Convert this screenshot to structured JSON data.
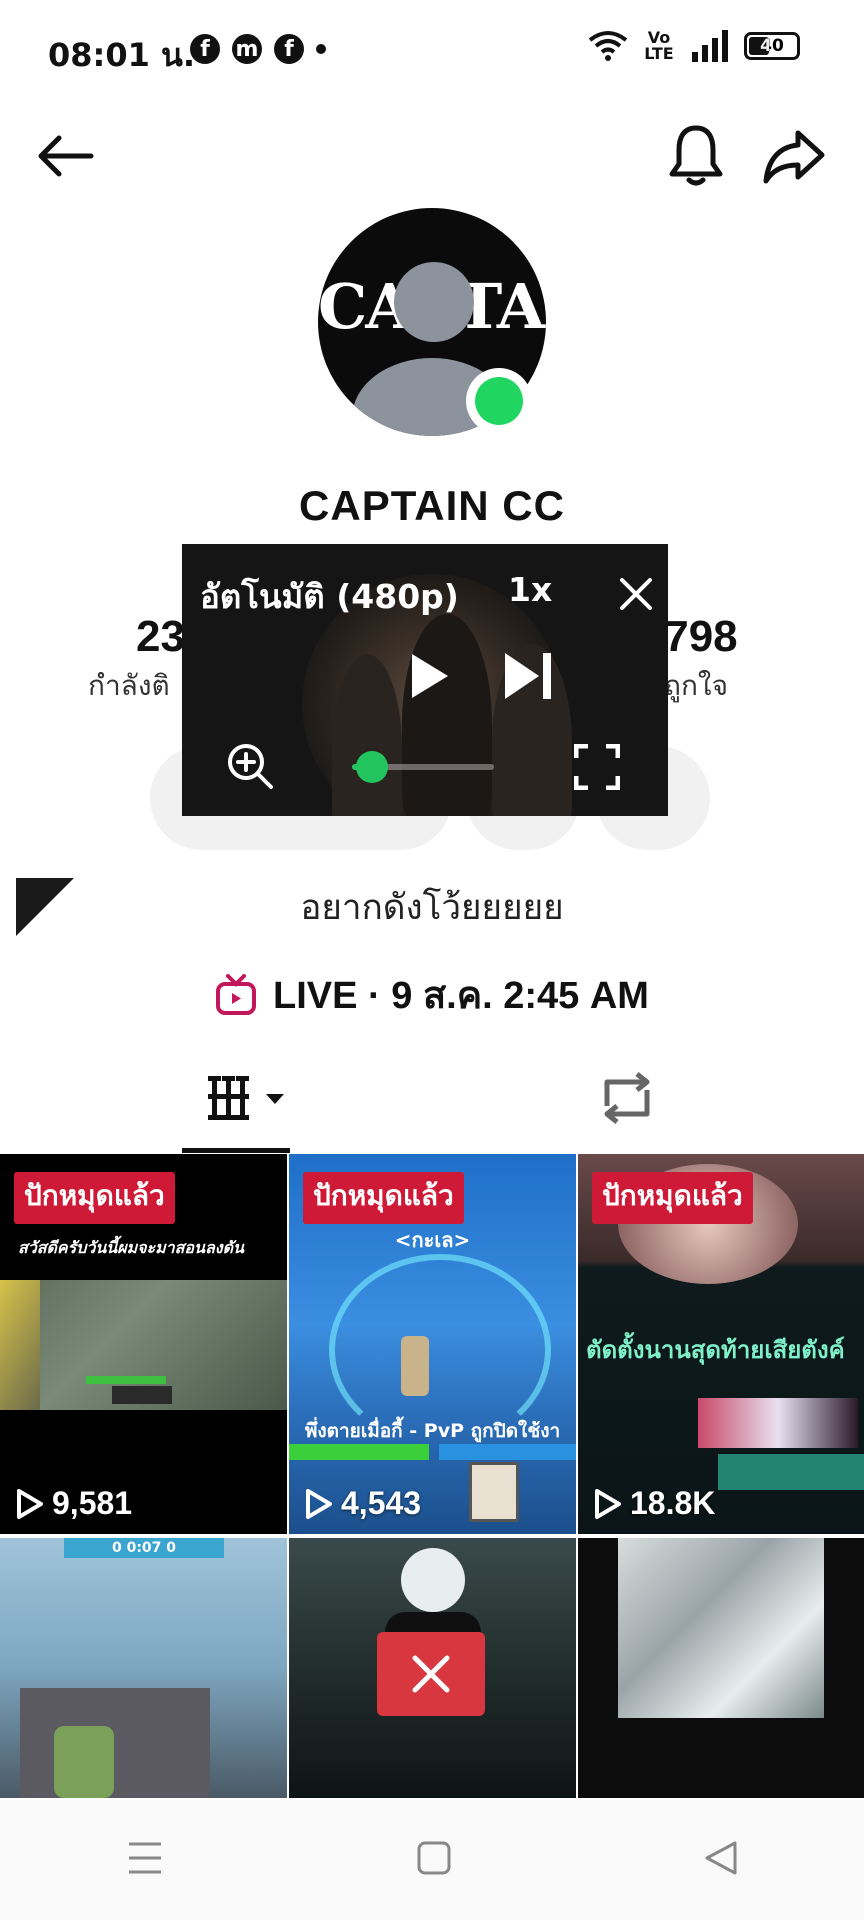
{
  "status_bar": {
    "time": "08:01 น.",
    "apps": [
      "f",
      "m",
      "f"
    ],
    "network": "Vo LTE",
    "battery": "40"
  },
  "profile": {
    "avatar_text": "CAPTAIN",
    "username": "CAPTAIN CC",
    "stats": {
      "following_value": "23",
      "following_label": "กำลังติ",
      "likes_value": ",798",
      "likes_label": "ถูกใจ"
    },
    "bio": "อยากดังโว้ยยยยย",
    "live": {
      "label": "LIVE · 9 ส.ค. 2:45 AM"
    }
  },
  "player": {
    "quality": "อัตโนมัติ (480p)",
    "speed": "1x",
    "progress": 0.14
  },
  "tabs": {
    "active": "videos"
  },
  "videos": [
    {
      "pinned": "ปักหมุดแล้ว",
      "caption": "สวัสดีครับวันนี้ผมจะมาสอนลงดัน",
      "views": "9,581"
    },
    {
      "pinned": "ปักหมุดแล้ว",
      "caption": "<กะเล>",
      "subcaption": "พึ่งตายเมื่อกี้ - PvP ถูกปิดใช้งา",
      "views": "4,543"
    },
    {
      "pinned": "ปักหมุดแล้ว",
      "caption": "ตัดตั้งนานสุดท้ายเสียตังค์",
      "views": "18.8K"
    },
    {
      "hud": "0 0:07 0"
    },
    {},
    {}
  ],
  "colors": {
    "accent_red": "#ce1a36",
    "online_green": "#20d660",
    "live_icon": "#c2185b"
  }
}
